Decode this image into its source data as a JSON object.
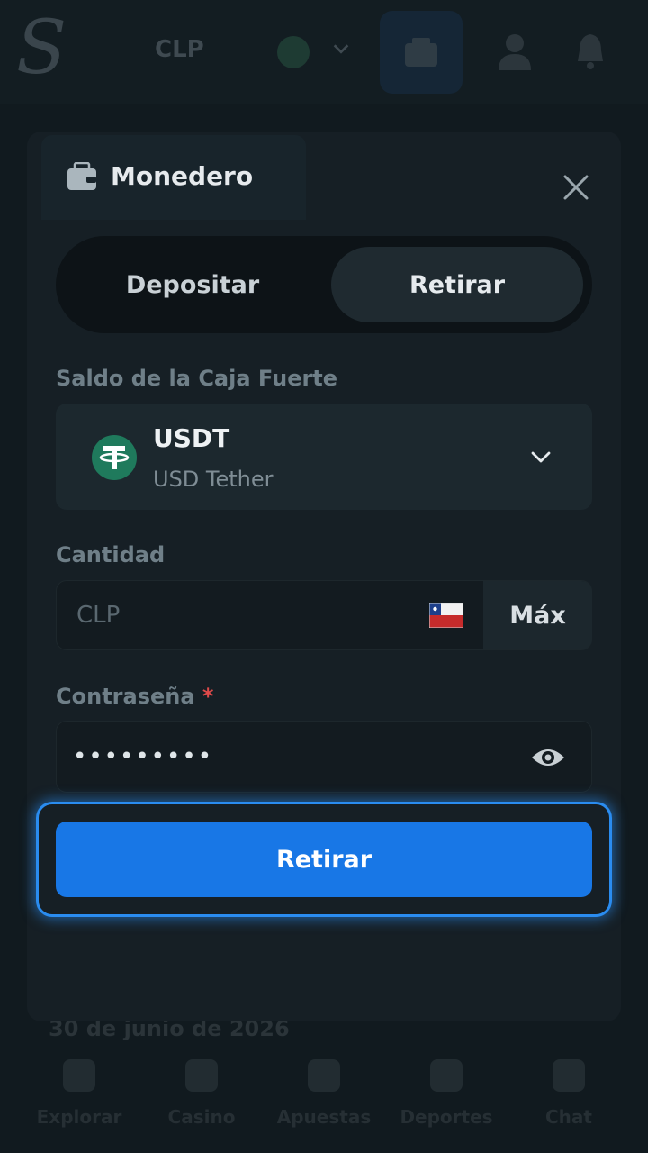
{
  "background": {
    "currency": "CLP",
    "date": "30 de junio de 2026",
    "nav": [
      {
        "label": "Explorar"
      },
      {
        "label": "Casino"
      },
      {
        "label": "Apuestas"
      },
      {
        "label": "Deportes"
      },
      {
        "label": "Chat"
      }
    ]
  },
  "modal": {
    "title": "Monedero",
    "tabs": {
      "deposit": "Depositar",
      "withdraw": "Retirar",
      "active": "withdraw"
    },
    "vault_label": "Saldo de la Caja Fuerte",
    "asset": {
      "code": "USDT",
      "name": "USD Tether",
      "icon": "tether-icon"
    },
    "amount_label": "Cantidad",
    "amount_placeholder": "CLP",
    "amount_flag": "chile-flag-icon",
    "max_label": "Máx",
    "password_label": "Contraseña",
    "password_required_mark": "*",
    "password_value": "•••••••••",
    "submit_label": "Retirar"
  },
  "colors": {
    "accent": "#1877e6",
    "tether": "#1f7a5c",
    "required": "#e04a4a"
  }
}
